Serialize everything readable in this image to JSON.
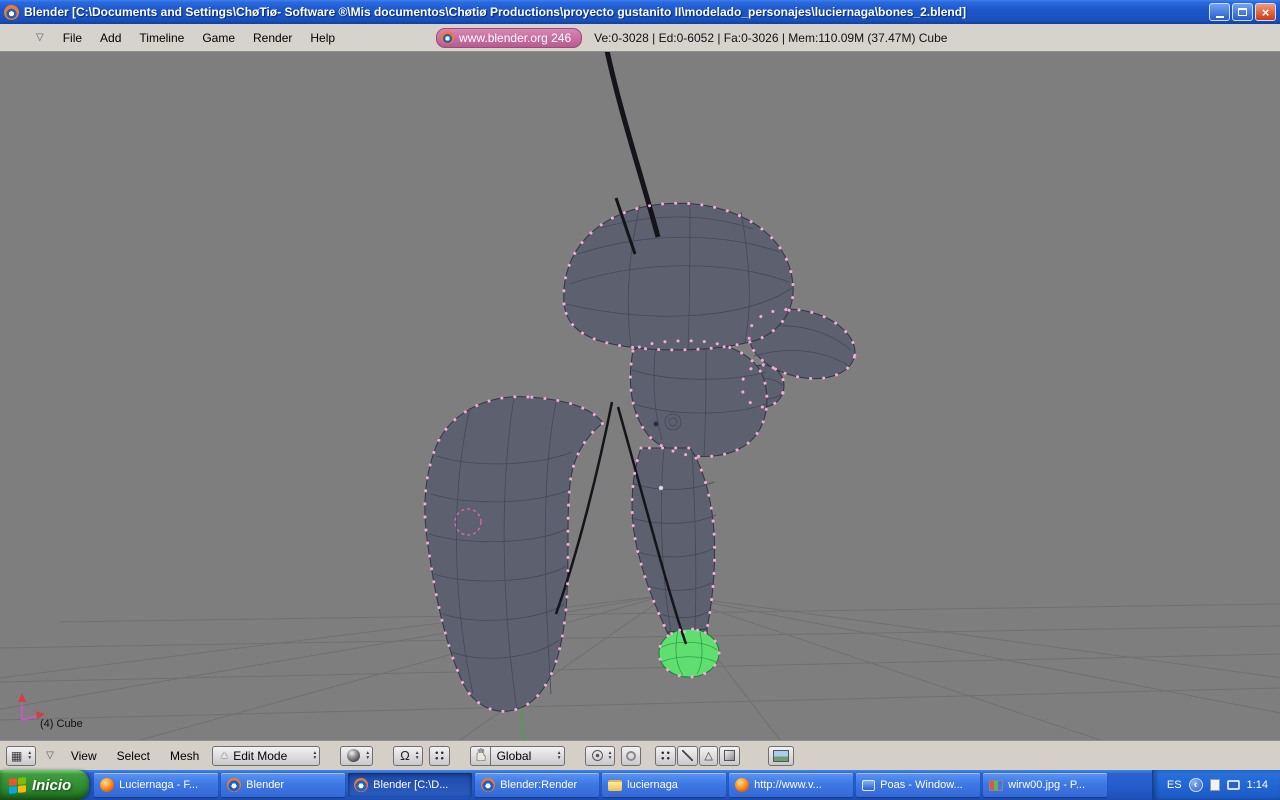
{
  "titlebar": {
    "title": "Blender [C:\\Documents and Settings\\ChøTiø- Software ®\\Mis documentos\\Chøtiø Productions\\proyecto gustanito II\\modelado_personajes\\luciernaga\\bones_2.blend]"
  },
  "menubar": {
    "items": [
      "File",
      "Add",
      "Timeline",
      "Game",
      "Render",
      "Help"
    ],
    "badge_label": "www.blender.org 246",
    "stats": "Ve:0-3028 | Ed:0-6052 | Fa:0-3026 | Mem:110.09M (37.47M) Cube"
  },
  "viewport": {
    "object_label": "(4) Cube"
  },
  "view_header": {
    "menus": [
      "View",
      "Select",
      "Mesh"
    ],
    "mode": "Edit Mode",
    "orientation": "Global"
  },
  "taskbar": {
    "start_label": "Inicio",
    "items": [
      {
        "label": "Luciernaga - F...",
        "icon": "firefox"
      },
      {
        "label": "Blender",
        "icon": "blender"
      },
      {
        "label": "Blender [C:\\D...",
        "icon": "blender"
      },
      {
        "label": "Blender:Render",
        "icon": "blender"
      },
      {
        "label": "luciernaga",
        "icon": "folder"
      },
      {
        "label": "http://www.v...",
        "icon": "firefox"
      },
      {
        "label": "Poas - Window...",
        "icon": "window"
      },
      {
        "label": "wirw00.jpg - P...",
        "icon": "image"
      }
    ],
    "tray": {
      "language": "ES",
      "time": "1:14"
    }
  }
}
